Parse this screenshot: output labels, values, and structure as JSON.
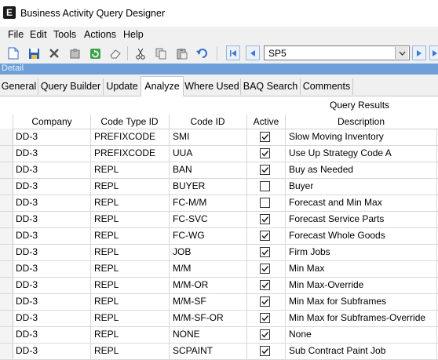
{
  "window": {
    "title": "Business Activity Query Designer",
    "app_icon": "E"
  },
  "menu": [
    "File",
    "Edit",
    "Tools",
    "Actions",
    "Help"
  ],
  "toolbar": {
    "query_id": "SP5"
  },
  "detail_label": "Detail",
  "tabs": [
    "General",
    "Query Builder",
    "Update",
    "Analyze",
    "Where Used",
    "BAQ Search",
    "Comments"
  ],
  "active_tab": "Analyze",
  "grid": {
    "title": "Query Results",
    "columns": [
      "Company",
      "Code Type ID",
      "Code ID",
      "Active",
      "Description"
    ],
    "rows": [
      {
        "company": "DD-3",
        "code_type": "PREFIXCODE",
        "code_id": "SMI",
        "active": true,
        "description": "Slow Moving Inventory"
      },
      {
        "company": "DD-3",
        "code_type": "PREFIXCODE",
        "code_id": "UUA",
        "active": true,
        "description": "Use Up Strategy Code A"
      },
      {
        "company": "DD-3",
        "code_type": "REPL",
        "code_id": "BAN",
        "active": true,
        "description": "Buy as Needed"
      },
      {
        "company": "DD-3",
        "code_type": "REPL",
        "code_id": "BUYER",
        "active": false,
        "description": "Buyer"
      },
      {
        "company": "DD-3",
        "code_type": "REPL",
        "code_id": "FC-M/M",
        "active": false,
        "description": "Forecast and Min Max"
      },
      {
        "company": "DD-3",
        "code_type": "REPL",
        "code_id": "FC-SVC",
        "active": true,
        "description": "Forecast Service Parts"
      },
      {
        "company": "DD-3",
        "code_type": "REPL",
        "code_id": "FC-WG",
        "active": true,
        "description": "Forecast Whole Goods"
      },
      {
        "company": "DD-3",
        "code_type": "REPL",
        "code_id": "JOB",
        "active": true,
        "description": "Firm Jobs"
      },
      {
        "company": "DD-3",
        "code_type": "REPL",
        "code_id": "M/M",
        "active": true,
        "description": "Min Max"
      },
      {
        "company": "DD-3",
        "code_type": "REPL",
        "code_id": "M/M-OR",
        "active": true,
        "description": "Min Max-Override"
      },
      {
        "company": "DD-3",
        "code_type": "REPL",
        "code_id": "M/M-SF",
        "active": true,
        "description": "Min Max for Subframes"
      },
      {
        "company": "DD-3",
        "code_type": "REPL",
        "code_id": "M/M-SF-OR",
        "active": true,
        "description": "Min Max for Subframes-Override"
      },
      {
        "company": "DD-3",
        "code_type": "REPL",
        "code_id": "NONE",
        "active": true,
        "description": "None"
      },
      {
        "company": "DD-3",
        "code_type": "REPL",
        "code_id": "SCPAINT",
        "active": true,
        "description": "Sub Contract Paint Job"
      }
    ]
  },
  "colors": {
    "detail_bar": "#6f9fd8",
    "toolbar_bg": "#f0f0f0",
    "nav_blue": "#3f7ad6"
  }
}
